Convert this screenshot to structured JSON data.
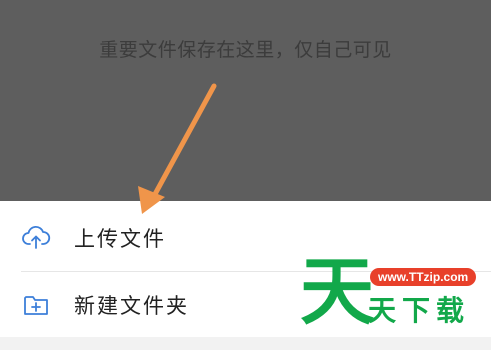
{
  "empty_state": {
    "hint": "重要文件保存在这里，仅自己可见"
  },
  "menu": {
    "items": [
      {
        "label": "上传文件",
        "icon": "cloud-upload-icon"
      },
      {
        "label": "新建文件夹",
        "icon": "folder-add-icon"
      }
    ]
  },
  "watermark": {
    "url": "www.TTzip.com",
    "big_char": "天",
    "brand": "天下载"
  },
  "colors": {
    "overlay": "#5e5e5e",
    "annotation_arrow": "#f0954a",
    "icon_blue": "#3d7fd9",
    "watermark_green": "#12a84a",
    "watermark_red": "#e8402a"
  }
}
